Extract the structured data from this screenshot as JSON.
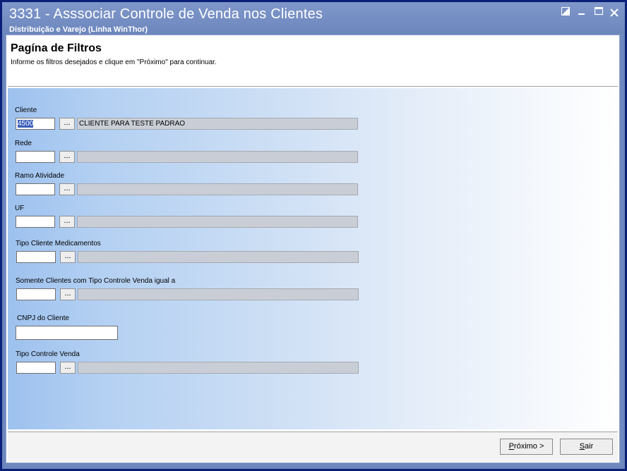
{
  "window": {
    "title": "3331 - Asssociar Controle de Venda nos Clientes",
    "subtitle": "Distribuição e Varejo (Linha WinThor)",
    "controls": {
      "restore_icon": "restore-icon",
      "minimize_icon": "minimize-icon",
      "maximize_icon": "maximize-icon",
      "close_icon": "close-icon"
    }
  },
  "header": {
    "title": "Pagína de Filtros",
    "description": "Informe os filtros desejados e clique em \"Próximo\" para continuar."
  },
  "filters": {
    "cliente": {
      "label": "Cliente",
      "code": "4500",
      "description": "CLIENTE PARA TESTE PADRAO",
      "lookup": "..."
    },
    "rede": {
      "label": "Rede",
      "code": "",
      "description": "",
      "lookup": "..."
    },
    "ramo": {
      "label": "Ramo Atividade",
      "code": "",
      "description": "",
      "lookup": "..."
    },
    "uf": {
      "label": "UF",
      "code": "",
      "description": "",
      "lookup": "..."
    },
    "tipo_medicamentos": {
      "label": "Tipo Cliente Medicamentos",
      "code": "",
      "description": "",
      "lookup": "..."
    },
    "somente_tipo": {
      "label": "Somente Clientes com Tipo Controle Venda igual a",
      "code": "",
      "description": "",
      "lookup": "..."
    },
    "cnpj": {
      "label": "CNPJ do Cliente",
      "value": ""
    },
    "tipo_controle": {
      "label": "Tipo Controle Venda",
      "code": "",
      "description": "",
      "lookup": "..."
    }
  },
  "footer": {
    "next_prefix": "P",
    "next_rest": "róximo >",
    "exit_prefix": "S",
    "exit_rest": "air"
  },
  "colors": {
    "title_bar": "#6c86bd",
    "frame_border": "#0a1f78",
    "filter_gradient_start": "#9dc1ee",
    "readonly_field": "#c9ced6"
  }
}
